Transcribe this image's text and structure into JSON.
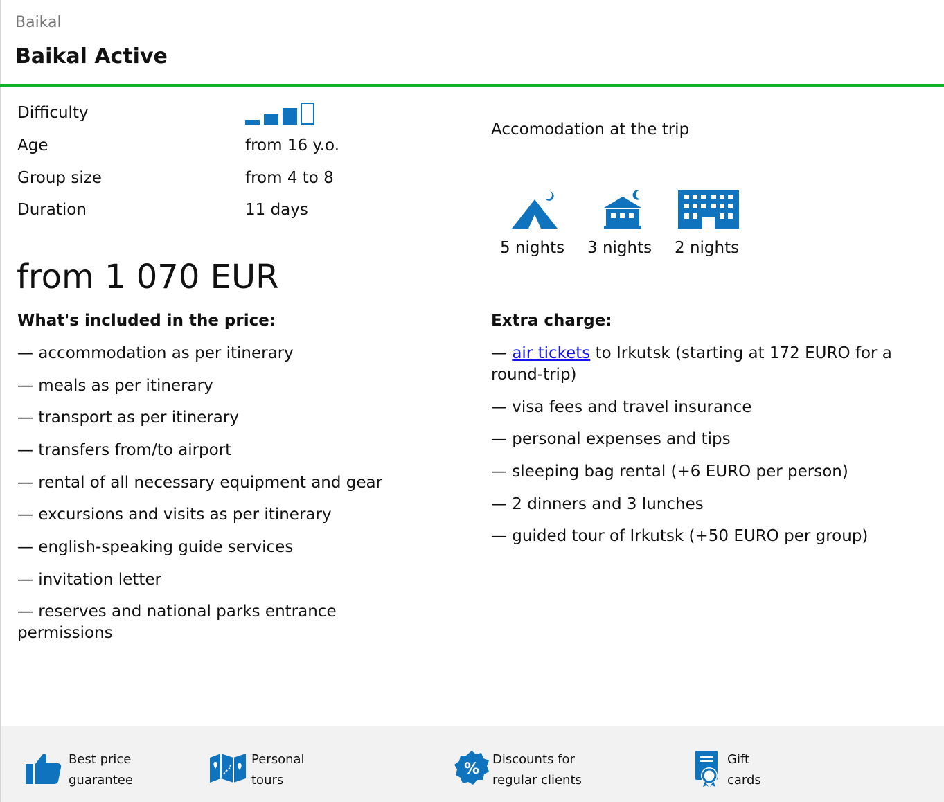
{
  "breadcrumb": "Baikal",
  "title": "Baikal Active",
  "specs": {
    "difficulty_label": "Difficulty",
    "difficulty_level": 3,
    "difficulty_max": 4,
    "age_label": "Age",
    "age_value": "from 16 y.o.",
    "group_label": "Group size",
    "group_value": "from 4 to 8",
    "duration_label": "Duration",
    "duration_value": "11 days"
  },
  "price": "from 1 070 EUR",
  "included": {
    "title": "What's included in the price:",
    "items": [
      "— accommodation as per itinerary",
      "— meals as per itinerary",
      "— transport as per itinerary",
      "— transfers from/to airport",
      "— rental of all necessary equipment and gear",
      "— excursions and visits as per itinerary",
      "— english-speaking guide services",
      "— invitation letter",
      "— reserves and national parks entrance permissions"
    ]
  },
  "accommodation": {
    "title": "Accomodation at the trip",
    "items": [
      {
        "icon": "tent-icon",
        "nights": "5 nights"
      },
      {
        "icon": "guesthouse-icon",
        "nights": "3 nights"
      },
      {
        "icon": "hotel-icon",
        "nights": "2 nights"
      }
    ]
  },
  "extra": {
    "title": "Extra charge:",
    "first_prefix": "— ",
    "first_link": "air tickets",
    "first_suffix": " to Irkutsk (starting at 172 EURO for a round-trip)",
    "items": [
      "— visa fees and travel insurance",
      "— personal expenses and tips",
      "— sleeping bag rental (+6 EURO per person)",
      "— 2 dinners and 3 lunches",
      "— guided tour of Irkutsk (+50 EURO per group)"
    ]
  },
  "footer": {
    "items": [
      {
        "icon": "thumbs-up-icon",
        "line1": "Best price",
        "line2": "guarantee"
      },
      {
        "icon": "map-icon",
        "line1": "Personal",
        "line2": "tours"
      },
      {
        "icon": "discount-badge-icon",
        "line1": "Discounts for",
        "line2": "regular clients"
      },
      {
        "icon": "gift-card-icon",
        "line1": "Gift",
        "line2": "cards"
      }
    ]
  },
  "colors": {
    "accent_blue": "#0f74bd",
    "green_rule": "#12b12b",
    "link": "#1414ee",
    "footer_bg": "#f2f2f2"
  }
}
